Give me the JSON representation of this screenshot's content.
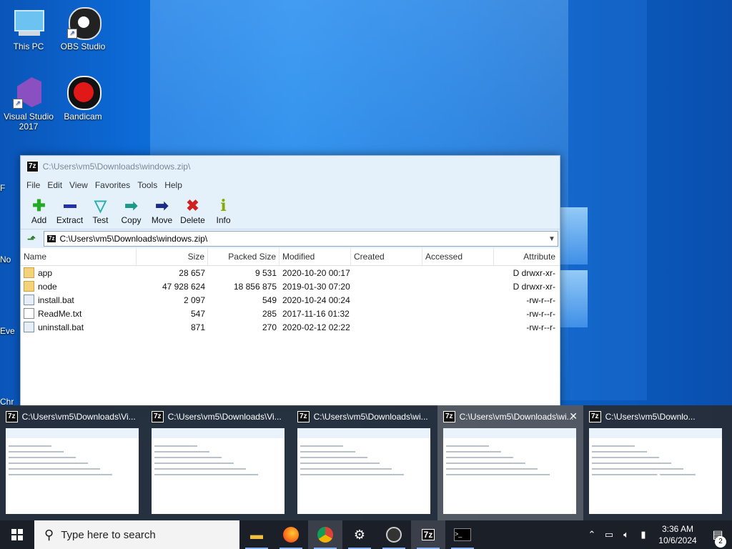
{
  "desktop": {
    "icons": [
      {
        "label": "This PC"
      },
      {
        "label": "OBS Studio"
      },
      {
        "label": "Visual Studio\n2017"
      },
      {
        "label": "Bandicam"
      }
    ],
    "partial_labels": [
      "F",
      "No",
      "Eve",
      "Chr"
    ]
  },
  "window": {
    "title": "C:\\Users\\vm5\\Downloads\\windows.zip\\",
    "menu": [
      "File",
      "Edit",
      "View",
      "Favorites",
      "Tools",
      "Help"
    ],
    "toolbar": [
      {
        "label": "Add",
        "icon": "plus-icon",
        "color": "#22aa22"
      },
      {
        "label": "Extract",
        "icon": "minus-icon",
        "color": "#2233aa"
      },
      {
        "label": "Test",
        "icon": "check-icon",
        "color": "#2ab0b0"
      },
      {
        "label": "Copy",
        "icon": "arrow-right-icon",
        "color": "#1a9a8a"
      },
      {
        "label": "Move",
        "icon": "arrow-right-icon",
        "color": "#1c2a8a"
      },
      {
        "label": "Delete",
        "icon": "x-icon",
        "color": "#d02020"
      },
      {
        "label": "Info",
        "icon": "info-icon",
        "color": "#88aa00"
      }
    ],
    "address": "C:\\Users\\vm5\\Downloads\\windows.zip\\",
    "columns": [
      "Name",
      "Size",
      "Packed Size",
      "Modified",
      "Created",
      "Accessed",
      "Attribute"
    ],
    "files": [
      {
        "name": "app",
        "type": "folder",
        "size": "28 657",
        "packed": "9 531",
        "modified": "2020-10-20 00:17",
        "created": "",
        "accessed": "",
        "attr": "D drwxr-xr-"
      },
      {
        "name": "node",
        "type": "folder",
        "size": "47 928 624",
        "packed": "18 856 875",
        "modified": "2019-01-30 07:20",
        "created": "",
        "accessed": "",
        "attr": "D drwxr-xr-"
      },
      {
        "name": "install.bat",
        "type": "bat",
        "size": "2 097",
        "packed": "549",
        "modified": "2020-10-24 00:24",
        "created": "",
        "accessed": "",
        "attr": "-rw-r--r-"
      },
      {
        "name": "ReadMe.txt",
        "type": "txt",
        "size": "547",
        "packed": "285",
        "modified": "2017-11-16 01:32",
        "created": "",
        "accessed": "",
        "attr": "-rw-r--r-"
      },
      {
        "name": "uninstall.bat",
        "type": "bat",
        "size": "871",
        "packed": "270",
        "modified": "2020-02-12 02:22",
        "created": "",
        "accessed": "",
        "attr": "-rw-r--r-"
      }
    ]
  },
  "previews": [
    {
      "title": "C:\\Users\\vm5\\Downloads\\Vi..."
    },
    {
      "title": "C:\\Users\\vm5\\Downloads\\Vi..."
    },
    {
      "title": "C:\\Users\\vm5\\Downloads\\wi..."
    },
    {
      "title": "C:\\Users\\vm5\\Downloads\\wi..."
    },
    {
      "title": "C:\\Users\\vm5\\Downlo..."
    }
  ],
  "taskbar": {
    "search_placeholder": "Type here to search",
    "apps": [
      "file-explorer",
      "firefox",
      "chrome",
      "settings",
      "obs",
      "7-zip",
      "terminal"
    ],
    "time": "3:36 AM",
    "date": "10/6/2024",
    "notification_count": "2"
  }
}
